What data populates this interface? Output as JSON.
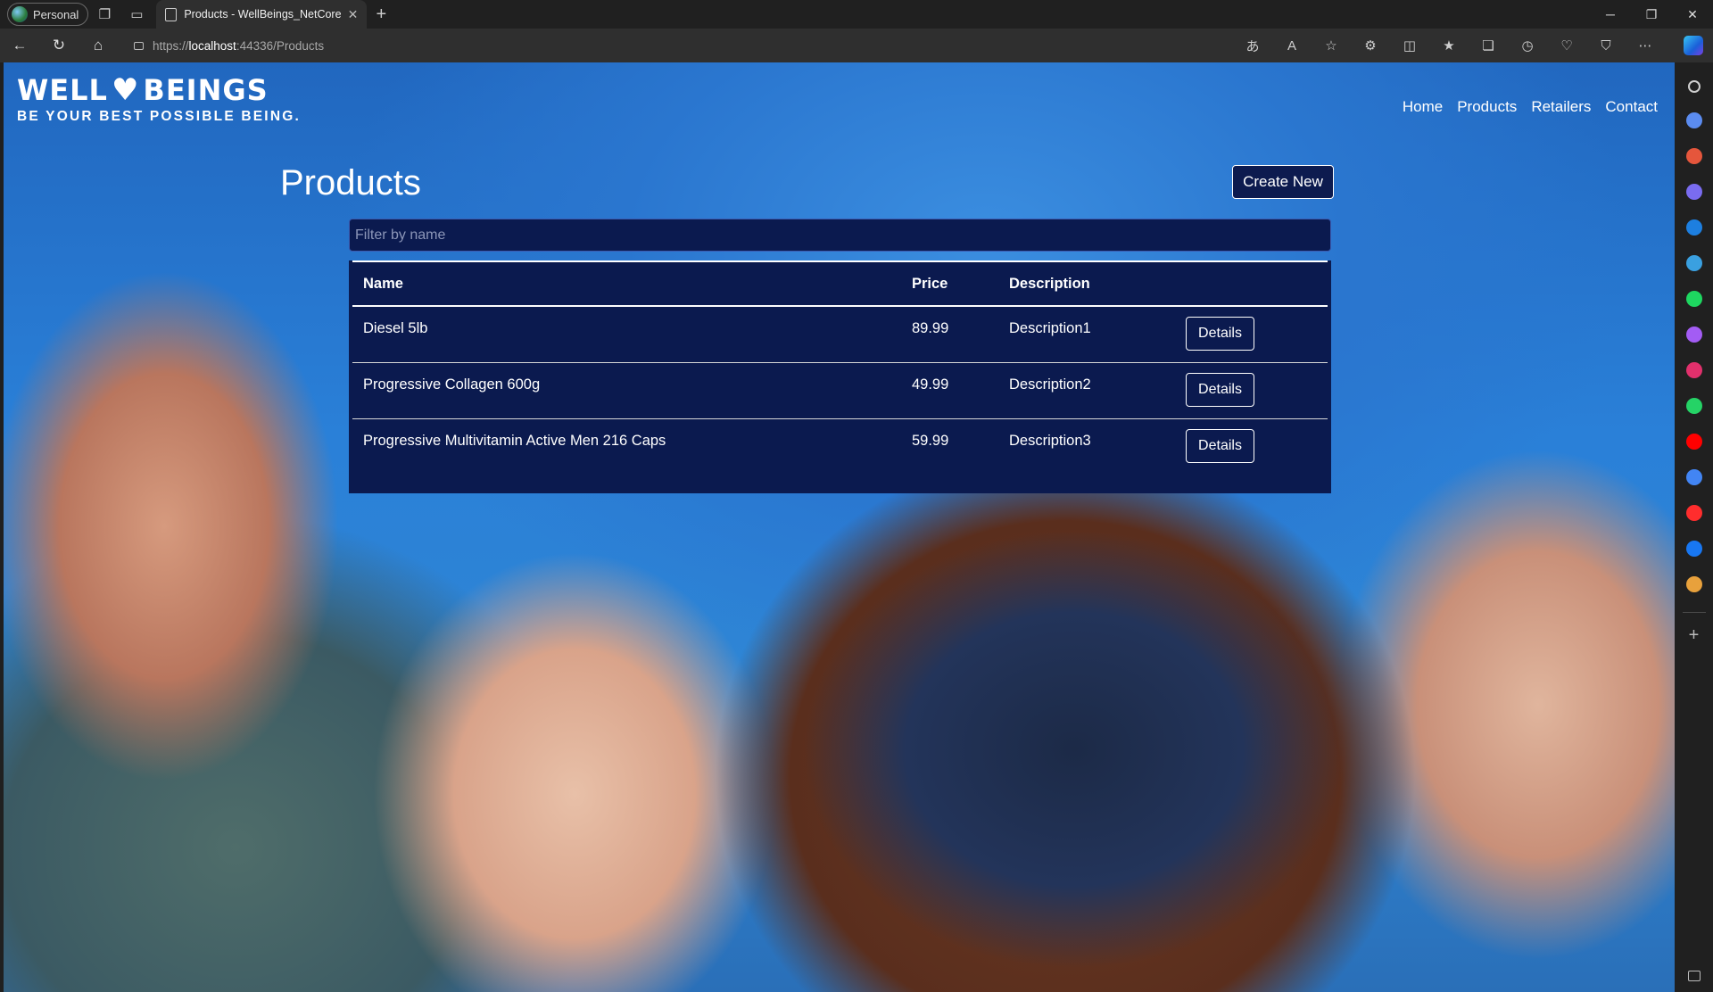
{
  "browser": {
    "profile_label": "Personal",
    "tab_title": "Products - WellBeings_NetCore/",
    "url_prefix": "https://",
    "url_host": "localhost",
    "url_rest": ":44336/Products"
  },
  "site": {
    "logo_text_left": "WELL",
    "logo_text_right": "BEINGS",
    "logo_tagline": "BE YOUR BEST POSSIBLE  BEING.",
    "nav": [
      "Home",
      "Products",
      "Retailers",
      "Contact"
    ]
  },
  "page": {
    "title": "Products",
    "create_button": "Create New",
    "filter_placeholder": "Filter by name"
  },
  "table": {
    "headers": [
      "Name",
      "Price",
      "Description",
      ""
    ],
    "rows": [
      {
        "name": "Diesel 5lb",
        "price": "89.99",
        "description": "Description1",
        "action": "Details"
      },
      {
        "name": "Progressive Collagen 600g",
        "price": "49.99",
        "description": "Description2",
        "action": "Details"
      },
      {
        "name": "Progressive Multivitamin Active Men 216 Caps",
        "price": "59.99",
        "description": "Description3",
        "action": "Details"
      }
    ]
  },
  "icons": {
    "edge_sidebar": [
      "search-icon",
      "tag-icon",
      "briefcase-icon",
      "games-icon",
      "outlook-icon",
      "telegram-icon",
      "spotify-icon",
      "messenger-icon",
      "instagram-icon",
      "whatsapp-icon",
      "youtube-icon",
      "google-icon",
      "youtube-music-icon",
      "facebook-icon",
      "amazon-icon"
    ],
    "sidebar_colors": [
      "#cfcfcf",
      "#5b8cf0",
      "#e5563c",
      "#7a6cf0",
      "#1d7fe0",
      "#3aa0e0",
      "#1ed760",
      "#a35cf4",
      "#e1306c",
      "#25d366",
      "#ff0000",
      "#4285f4",
      "#ff2d2d",
      "#1877f2",
      "#e8a13c"
    ]
  }
}
